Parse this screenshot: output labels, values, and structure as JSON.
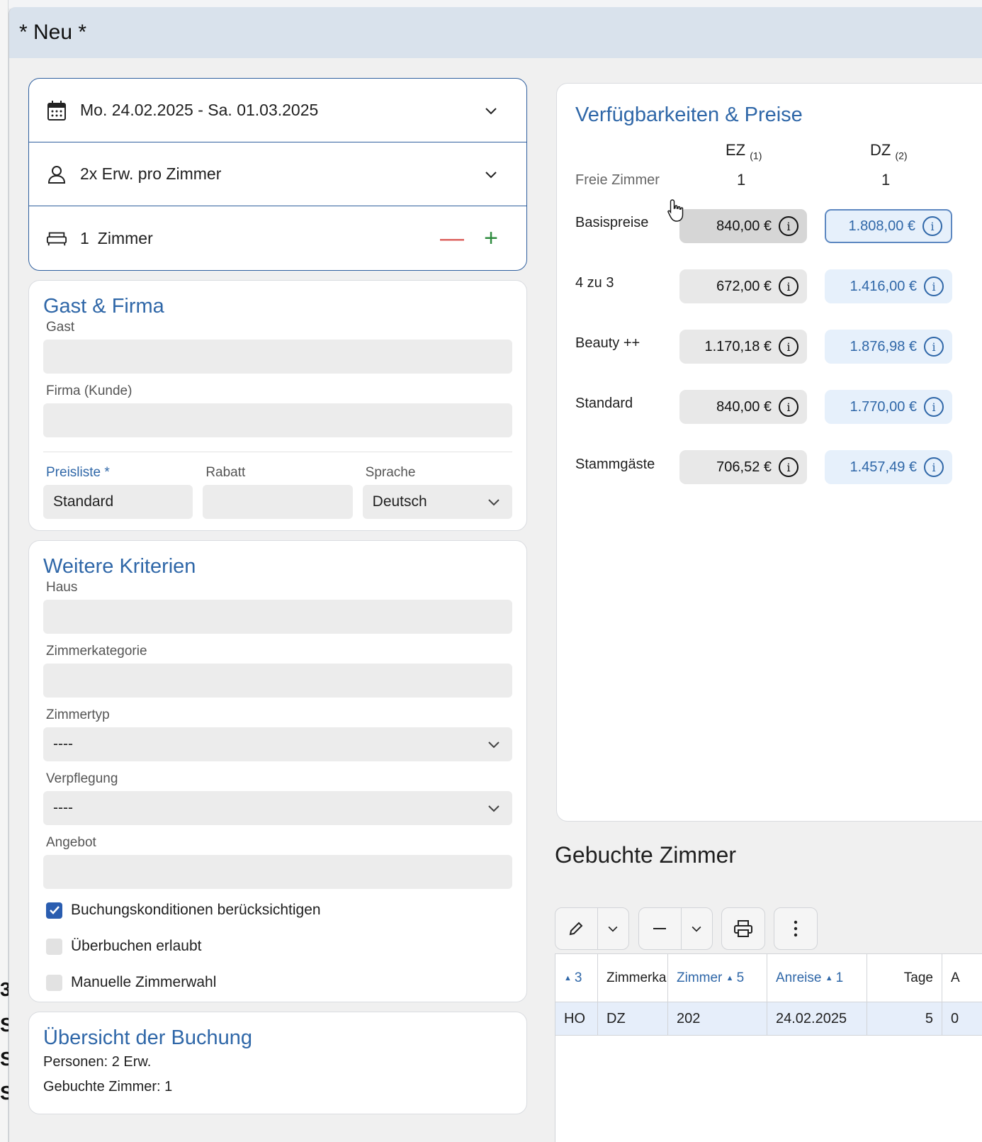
{
  "dialog": {
    "title": "* Neu *"
  },
  "search": {
    "dates": "Mo. 24.02.2025 - Sa. 01.03.2025",
    "persons": "2x Erw. pro Zimmer",
    "rooms_count": "1",
    "rooms_label": "Zimmer",
    "minus": "—",
    "plus": "+"
  },
  "gast_firma": {
    "title": "Gast & Firma",
    "gast_label": "Gast",
    "gast_value": "",
    "firma_label": "Firma (Kunde)",
    "firma_value": "",
    "preisliste_label": "Preisliste *",
    "preisliste_value": "Standard",
    "rabatt_label": "Rabatt",
    "rabatt_value": "",
    "sprache_label": "Sprache",
    "sprache_value": "Deutsch"
  },
  "kriterien": {
    "title": "Weitere Kriterien",
    "haus_label": "Haus",
    "haus_value": "",
    "zimmerkategorie_label": "Zimmerkategorie",
    "zimmerkategorie_value": "",
    "zimmertyp_label": "Zimmertyp",
    "zimmertyp_value": "----",
    "verpflegung_label": "Verpflegung",
    "verpflegung_value": "----",
    "angebot_label": "Angebot",
    "angebot_value": "",
    "checkboxes": [
      {
        "label": "Buchungskonditionen berücksichtigen",
        "checked": true
      },
      {
        "label": "Überbuchen erlaubt",
        "checked": false
      },
      {
        "label": "Manuelle Zimmerwahl",
        "checked": false
      }
    ]
  },
  "uebersicht": {
    "title": "Übersicht der Buchung",
    "personen": "Personen: 2 Erw.",
    "gebuchte": "Gebuchte Zimmer: 1"
  },
  "preise": {
    "title": "Verfügbarkeiten & Preise",
    "col_ez": "EZ",
    "col_ez_sub": "(1)",
    "col_dz": "DZ",
    "col_dz_sub": "(2)",
    "freie_label": "Freie Zimmer",
    "freie_ez": "1",
    "freie_dz": "1",
    "rows": [
      {
        "label": "Basispreise",
        "ez": "840,00 €",
        "dz": "1.808,00 €"
      },
      {
        "label": "4 zu 3",
        "ez": "672,00 €",
        "dz": "1.416,00 €"
      },
      {
        "label": "Beauty ++",
        "ez": "1.170,18 €",
        "dz": "1.876,98 €"
      },
      {
        "label": "Standard",
        "ez": "840,00 €",
        "dz": "1.770,00 €"
      },
      {
        "label": "Stammgäste",
        "ez": "706,52 €",
        "dz": "1.457,49 €"
      }
    ],
    "info_glyph": "i"
  },
  "gebucht": {
    "title": "Gebuchte Zimmer",
    "headers": {
      "c1": "3",
      "c2": "Zimmerka",
      "c3": "Zimmer",
      "c3n": "5",
      "c4": "Anreise",
      "c4n": "1",
      "c5": "Tage",
      "c6": "A"
    },
    "row": {
      "c1": "HO",
      "c2": "DZ",
      "c3": "202",
      "c4": "24.02.2025",
      "c5": "5",
      "c6": "0"
    }
  },
  "bg_glyphs": [
    "3",
    "S",
    "S",
    "S"
  ],
  "colors": {
    "accent": "#2f67a8",
    "titlebar": "#d9e2ec",
    "checkbox_on": "#2a5db0"
  }
}
